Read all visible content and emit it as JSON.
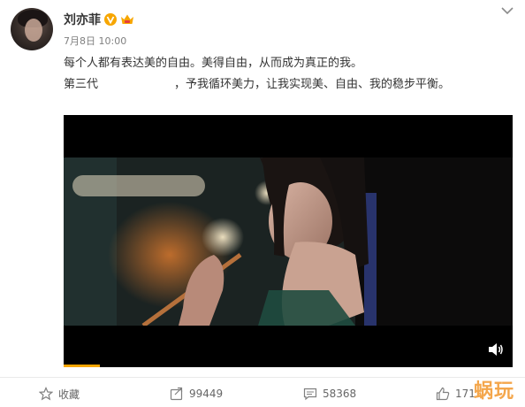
{
  "post": {
    "username": "刘亦菲",
    "timestamp": "7月8日 10:00",
    "text_line1": "每个人都有表达美的自由。美得自由，从而成为真正的我。",
    "text_line2_prefix": "第三代",
    "text_line2_suffix": "，予我循环美力，让我实现美、自由、我的稳步平衡。"
  },
  "icons": {
    "verified": "verified-v-icon",
    "member": "crown-member-icon",
    "menu": "chevron-down-icon",
    "mute": "speaker-mute-icon",
    "favorite": "star-icon",
    "forward": "share-icon",
    "comment": "comment-icon",
    "like": "thumbs-up-icon"
  },
  "video": {
    "progress_fraction": 0.08
  },
  "actions": {
    "favorite_label": "收藏",
    "forward_count": "99449",
    "comment_count": "58368",
    "like_count": "171"
  },
  "watermark": "蜗玩",
  "colors": {
    "accent": "#f7a600",
    "text": "#333333",
    "muted": "#808080",
    "video_bg": "#000000",
    "watermark": "#f4a64b"
  }
}
